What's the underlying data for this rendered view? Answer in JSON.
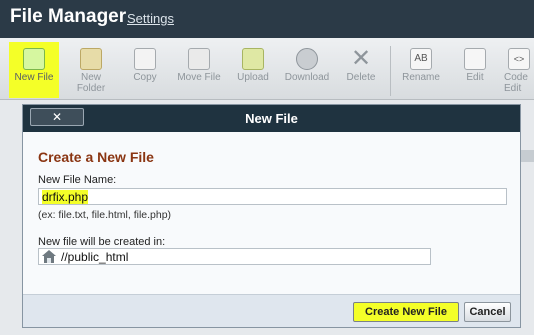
{
  "header": {
    "title": "File Manager",
    "settings_link": "Settings"
  },
  "toolbar": {
    "items": [
      {
        "label": "New File",
        "icon": "new-file-icon"
      },
      {
        "label": "New\nFolder",
        "icon": "new-folder-icon"
      },
      {
        "label": "Copy",
        "icon": "copy-icon"
      },
      {
        "label": "Move File",
        "icon": "move-file-icon"
      },
      {
        "label": "Upload",
        "icon": "upload-icon"
      },
      {
        "label": "Download",
        "icon": "download-icon"
      },
      {
        "label": "Delete",
        "icon": "delete-icon"
      },
      {
        "label": "Rename",
        "icon": "rename-icon"
      },
      {
        "label": "Edit",
        "icon": "edit-icon"
      },
      {
        "label": "Code\nEdit",
        "icon": "code-edit-icon"
      }
    ]
  },
  "modal": {
    "title": "New File",
    "close_label": "✕",
    "section_title": "Create a New File",
    "file_name_label": "New File Name:",
    "file_name_value": "drfix.php",
    "file_name_hint": "(ex: file.txt, file.html, file.php)",
    "location_label": "New file will be created in:",
    "location_value": "//public_html",
    "create_button": "Create New File",
    "cancel_button": "Cancel"
  },
  "colors": {
    "highlight": "#f4ff28",
    "header_bg": "#2b3a47",
    "modal_header": "#1f3340",
    "section_title": "#8a3512"
  }
}
